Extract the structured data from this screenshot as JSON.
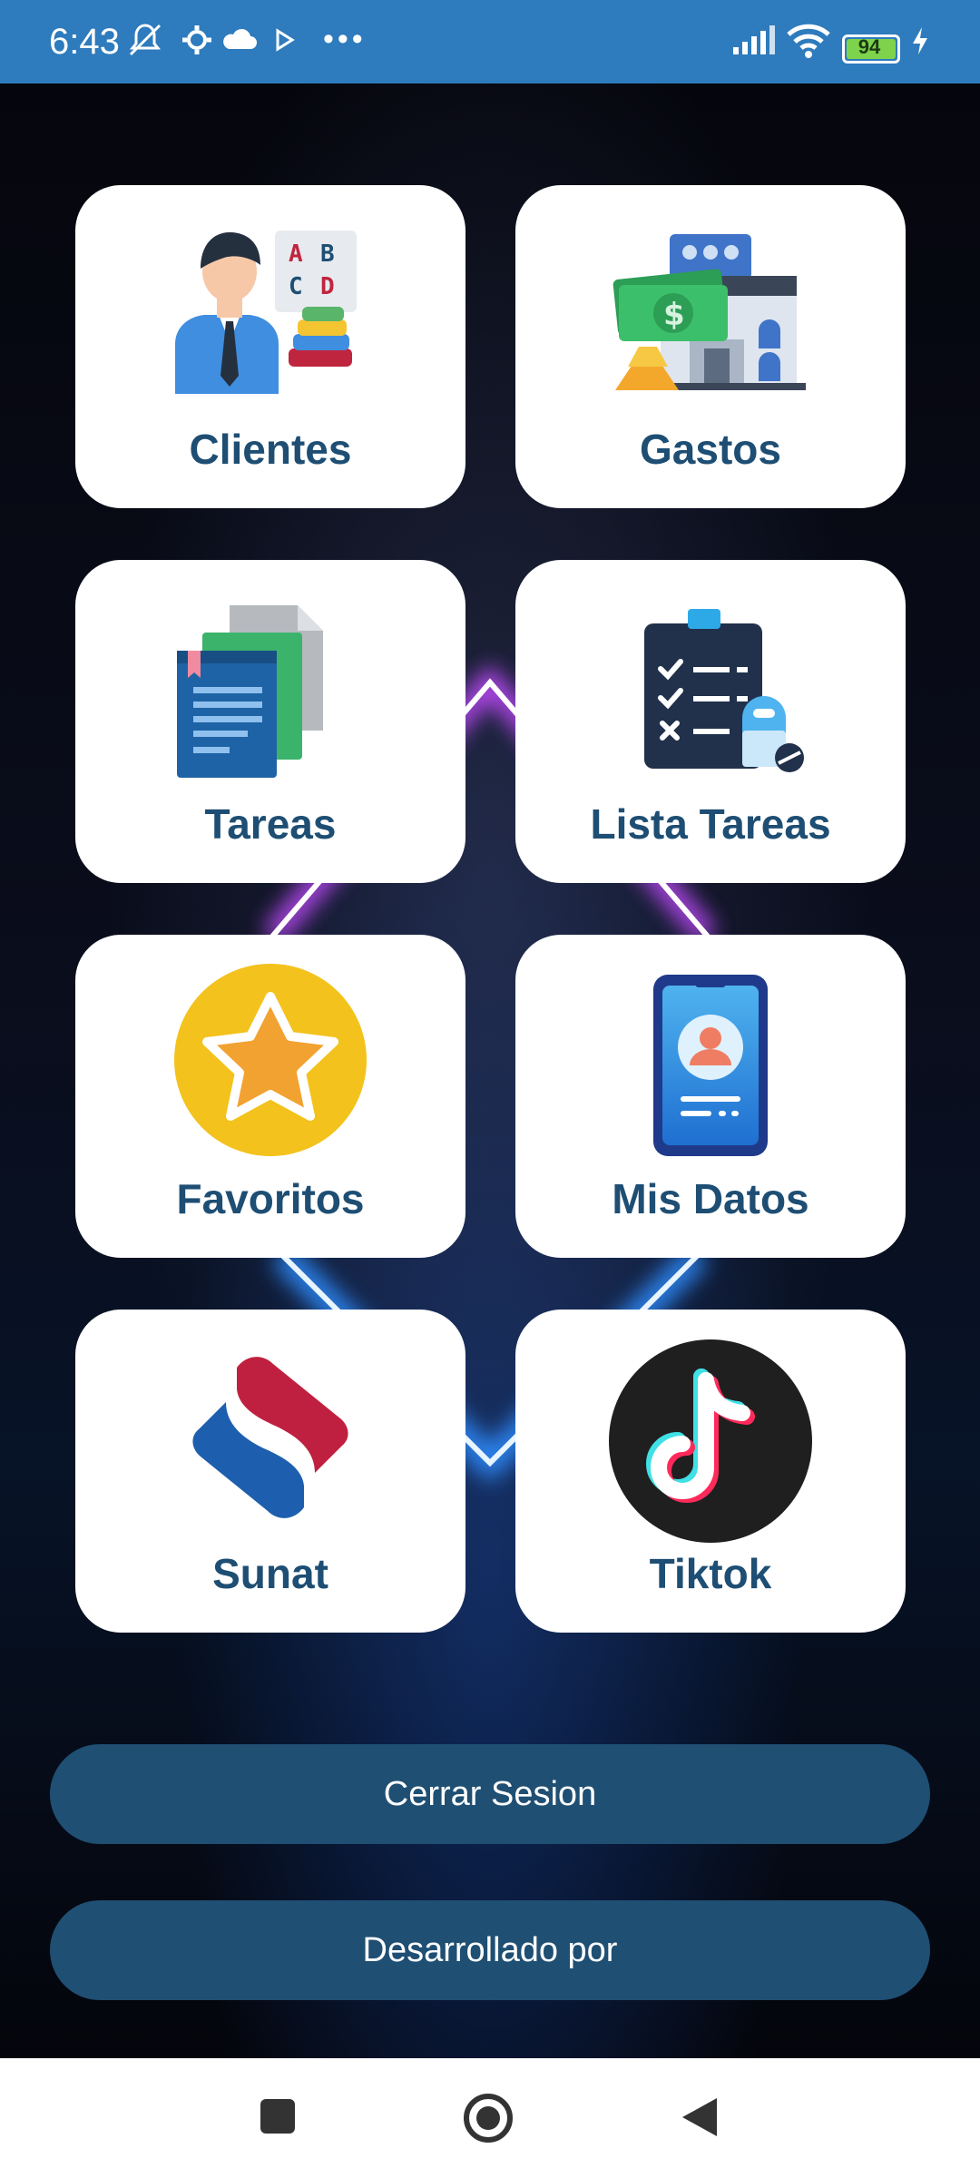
{
  "status_bar": {
    "time": "6:43",
    "battery": "94"
  },
  "tiles": [
    {
      "label": "Clientes",
      "icon": "client-icon"
    },
    {
      "label": "Gastos",
      "icon": "expenses-icon"
    },
    {
      "label": "Tareas",
      "icon": "documents-icon"
    },
    {
      "label": "Lista Tareas",
      "icon": "checklist-icon"
    },
    {
      "label": "Favoritos",
      "icon": "star-icon"
    },
    {
      "label": "Mis Datos",
      "icon": "profile-phone-icon"
    },
    {
      "label": "Sunat",
      "icon": "sunat-logo-icon"
    },
    {
      "label": "Tiktok",
      "icon": "tiktok-logo-icon"
    }
  ],
  "buttons": {
    "logout": "Cerrar Sesion",
    "developer": "Desarrollado por"
  },
  "colors": {
    "status_bar": "#2e7bbd",
    "tile_label": "#1e4e73",
    "button": "#1f4f73"
  }
}
